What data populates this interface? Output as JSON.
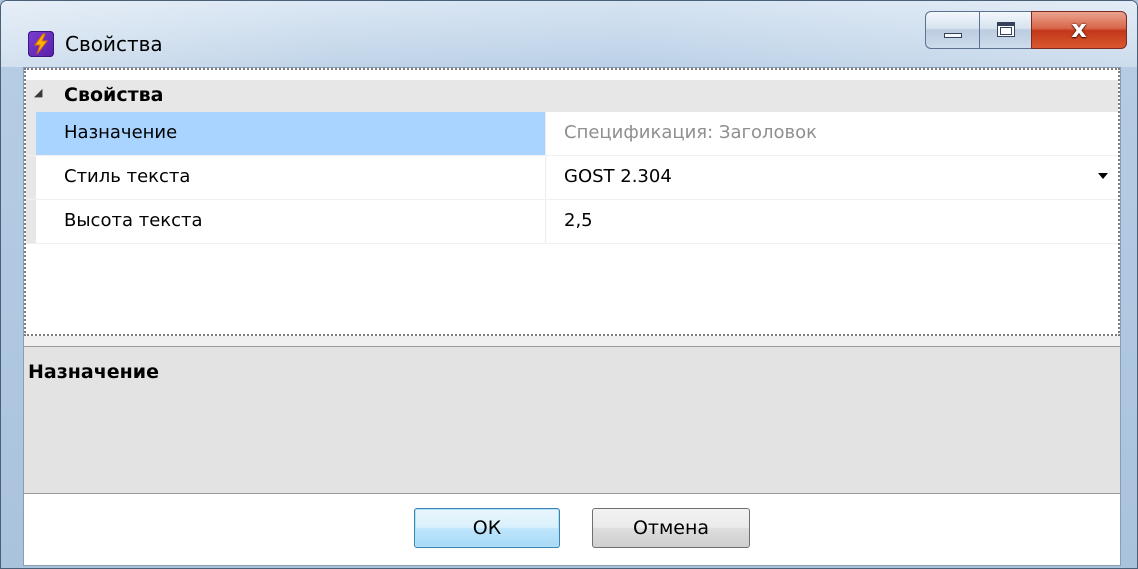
{
  "window": {
    "title": "Свойства"
  },
  "grid": {
    "category": "Свойства",
    "rows": [
      {
        "name": "Назначение",
        "value": "Спецификация: Заголовок",
        "readonly": true,
        "selected": true
      },
      {
        "name": "Стиль текста",
        "value": "GOST 2.304",
        "dropdown": true
      },
      {
        "name": "Высота текста",
        "value": "2,5"
      }
    ]
  },
  "description": {
    "title": "Назначение"
  },
  "buttons": {
    "ok_label": "ОК",
    "cancel_label": "Отмена"
  },
  "colors": {
    "selected_row": "#a9d4ff",
    "readonly_text": "#8f8f8f",
    "close_button": "#c2371a"
  },
  "icons": {
    "app": "lightning-icon",
    "minimize": "minimize-icon",
    "maximize": "maximize-icon",
    "close": "close-icon",
    "collapse": "collapse-triangle-icon",
    "dropdown": "dropdown-arrow-icon"
  }
}
